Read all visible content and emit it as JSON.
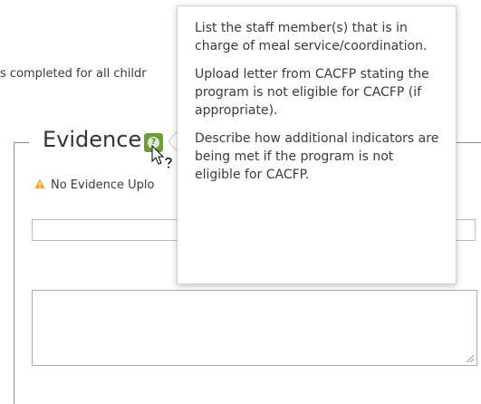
{
  "background_text": "s completed for all childr",
  "evidence": {
    "title": "Evidence",
    "help_icon": "question-mark-icon",
    "warning_icon": "warning-triangle-icon",
    "warning_color": "#f0a830",
    "help_color": "#6e9e3a",
    "no_evidence_text": "No Evidence Uplo"
  },
  "tooltip": {
    "paragraphs": [
      "List the staff member(s) that is in charge of meal service/coordination.",
      "Upload letter from CACFP stating the program is not eligible for CACFP (if appropriate).",
      "Describe how additional indicators are being met if the program is not eligible for CACFP."
    ]
  },
  "text_input": {
    "value": ""
  },
  "textarea": {
    "value": ""
  }
}
